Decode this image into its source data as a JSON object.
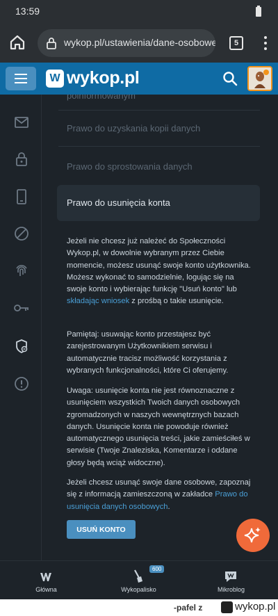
{
  "status_bar": {
    "time": "13:59"
  },
  "browser": {
    "url": "wykop.pl/ustawienia/dane-osobowe/pr",
    "tab_count": "5"
  },
  "header": {
    "logo_mark": "W",
    "logo_text": "wykop.pl"
  },
  "sidebar": {
    "icons": [
      "mail-icon",
      "lock-icon",
      "phone-icon",
      "block-icon",
      "fingerprint-icon",
      "key-icon",
      "shield-icon",
      "alert-icon"
    ]
  },
  "settings_menu": {
    "partial_item": "poinformowanym",
    "items": [
      "Prawo do uzyskania kopii danych",
      "Prawo do sprostowania danych",
      "Prawo do usunięcia konta"
    ]
  },
  "content": {
    "p1_text": "Jeżeli nie chcesz już należeć do Społeczności Wykop.pl, w dowolnie wybranym przez Ciebie momencie, możesz usunąć swoje konto użytkownika. Możesz wykonać to samodzielnie, logując się na swoje konto i wybierając funkcję \"Usuń konto\" lub ",
    "p1_link": "składając wniosek",
    "p1_suffix": " z prośbą o takie usunięcie.",
    "p2": "Pamiętaj: usuwając konto przestajesz być zarejestrowanym Użytkownikiem serwisu i automatycznie tracisz możliwość korzystania z wybranych funkcjonalności, które Ci oferujemy.",
    "p3": "Uwaga: usunięcie konta nie jest równoznaczne z usunięciem wszystkich Twoich danych osobowych zgromadzonych w naszych wewnętrznych bazach danych. Usunięcie konta nie powoduje również automatycznego usunięcia treści, jakie zamieściłeś w serwisie (Twoje Znaleziska, Komentarze i oddane głosy będą wciąż widoczne).",
    "p4_text": "Jeżeli chcesz usunąć swoje dane osobowe, zapoznaj się z informacją zamieszczoną w zakładce ",
    "p4_link": "Prawo do usunięcia danych osobowych",
    "p4_suffix": ".",
    "delete_button": "USUŃ KONTO"
  },
  "bottom_nav": {
    "items": [
      {
        "label": "Główna"
      },
      {
        "label": "Wykopalisko",
        "badge": "600"
      },
      {
        "label": "Mikroblog"
      }
    ]
  },
  "watermark": {
    "user": "-pafel z",
    "logo_text": "wykop.pl"
  },
  "colors": {
    "brand": "#0f6ba4",
    "accent": "#4a8fbf",
    "fab": "#f06a3a",
    "background": "#1d2329",
    "link": "#4a9fd6"
  }
}
